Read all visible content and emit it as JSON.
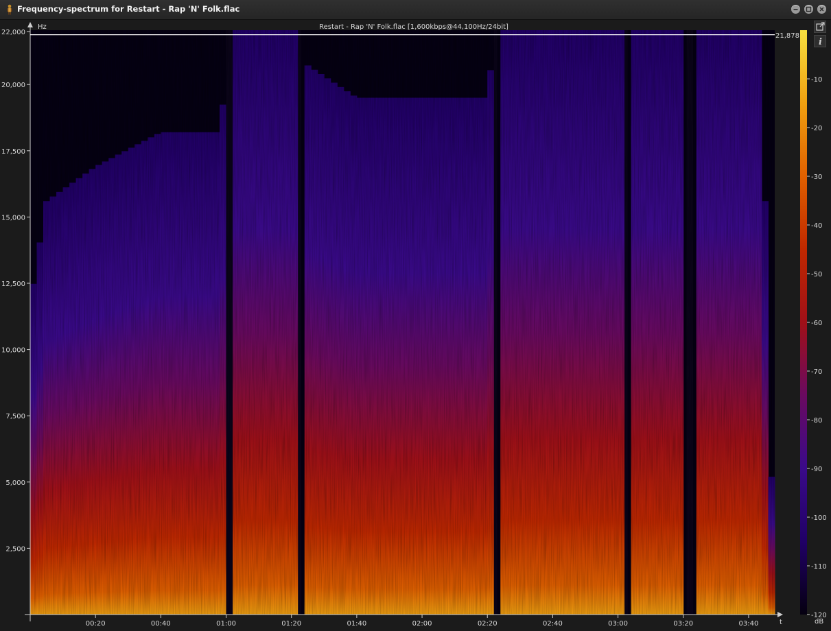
{
  "window": {
    "title": "Frequency-spectrum for Restart - Rap 'N' Folk.flac",
    "controls": [
      "minimize",
      "maximize",
      "close"
    ]
  },
  "side_buttons": [
    "popout-icon",
    "info-icon"
  ],
  "chart_data": {
    "type": "heatmap",
    "title": "Restart - Rap 'N' Folk.flac [1,600kbps@44,100Hz/24bit]",
    "xlabel": "t",
    "ylabel": "Hz",
    "y_ticks": [
      "22,000",
      "20,000",
      "17,500",
      "15,000",
      "12,500",
      "10,000",
      "7,500",
      "5,000",
      "2,500"
    ],
    "y_tick_values": [
      22000,
      20000,
      17500,
      15000,
      12500,
      10000,
      7500,
      5000,
      2500
    ],
    "x_ticks": [
      "00:20",
      "00:40",
      "01:00",
      "01:20",
      "01:40",
      "02:00",
      "02:20",
      "02:40",
      "03:00",
      "03:20",
      "03:40"
    ],
    "x_tick_values_s": [
      20,
      40,
      60,
      80,
      100,
      120,
      140,
      160,
      180,
      200,
      220
    ],
    "xlim_s": [
      0,
      228
    ],
    "ylim_hz": [
      0,
      22050
    ],
    "cutoff_label": "21,878",
    "cutoff_hz": 21878,
    "colorbar": {
      "label": "dB",
      "ticks": [
        "-10",
        "-20",
        "-30",
        "-40",
        "-50",
        "-60",
        "-70",
        "-80",
        "-90",
        "-100",
        "-110",
        "-120"
      ],
      "tick_values": [
        -10,
        -20,
        -30,
        -40,
        -50,
        -60,
        -70,
        -80,
        -90,
        -100,
        -110,
        -120
      ],
      "range_db": [
        -120,
        0
      ],
      "colors": [
        "#050010",
        "#200066",
        "#3a0a8a",
        "#6a0a60",
        "#a01018",
        "#c02800",
        "#e06000",
        "#f0a010",
        "#f8e040"
      ]
    },
    "quiet_gaps_s": [
      [
        60,
        62
      ],
      [
        82,
        83
      ],
      [
        142,
        143
      ],
      [
        182,
        183
      ],
      [
        201,
        203
      ]
    ],
    "energy_profile": {
      "t_s": [
        0,
        5,
        20,
        40,
        58,
        63,
        80,
        84,
        100,
        120,
        140,
        145,
        160,
        180,
        184,
        200,
        204,
        222,
        228
      ],
      "bright_hz": [
        4500,
        6000,
        6500,
        7000,
        7000,
        9000,
        12000,
        8000,
        7500,
        7500,
        7500,
        9500,
        9000,
        8500,
        10000,
        9500,
        13000,
        12000,
        0
      ]
    }
  }
}
